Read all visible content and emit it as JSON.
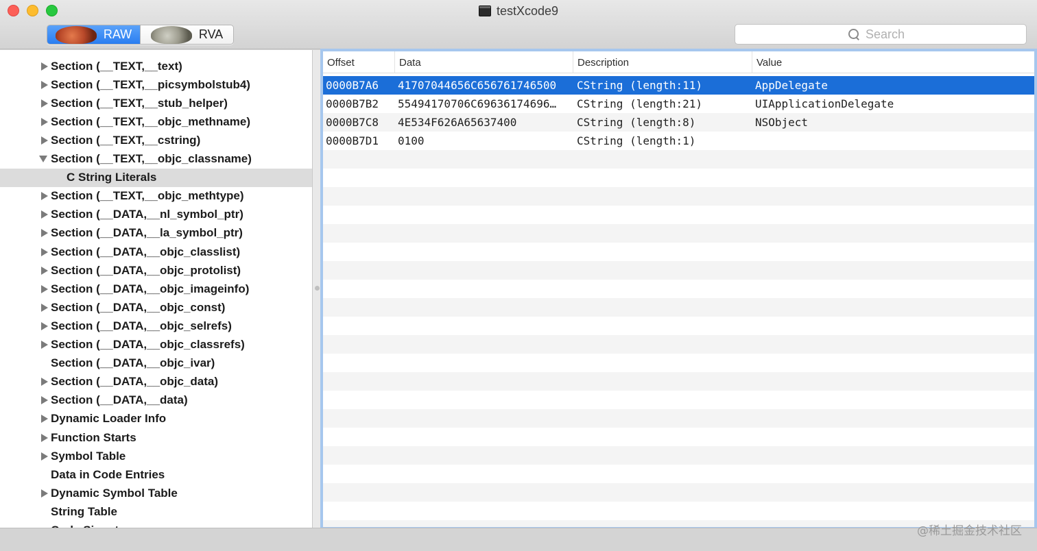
{
  "window": {
    "title": "testXcode9"
  },
  "toolbar": {
    "segments": [
      {
        "label": "RAW",
        "selected": true
      },
      {
        "label": "RVA",
        "selected": false
      }
    ],
    "search": {
      "placeholder": "Search",
      "value": ""
    }
  },
  "outline": {
    "items": [
      {
        "label": "Section (__TEXT,__text)",
        "disclosure": "closed",
        "level": 1
      },
      {
        "label": "Section (__TEXT,__picsymbolstub4)",
        "disclosure": "closed",
        "level": 1
      },
      {
        "label": "Section (__TEXT,__stub_helper)",
        "disclosure": "closed",
        "level": 1
      },
      {
        "label": "Section (__TEXT,__objc_methname)",
        "disclosure": "closed",
        "level": 1
      },
      {
        "label": "Section (__TEXT,__cstring)",
        "disclosure": "closed",
        "level": 1
      },
      {
        "label": "Section (__TEXT,__objc_classname)",
        "disclosure": "open",
        "level": 1
      },
      {
        "label": "C String Literals",
        "disclosure": "none",
        "level": 2,
        "selected": true
      },
      {
        "label": "Section (__TEXT,__objc_methtype)",
        "disclosure": "closed",
        "level": 1
      },
      {
        "label": "Section (__DATA,__nl_symbol_ptr)",
        "disclosure": "closed",
        "level": 1
      },
      {
        "label": "Section (__DATA,__la_symbol_ptr)",
        "disclosure": "closed",
        "level": 1
      },
      {
        "label": "Section (__DATA,__objc_classlist)",
        "disclosure": "closed",
        "level": 1
      },
      {
        "label": "Section (__DATA,__objc_protolist)",
        "disclosure": "closed",
        "level": 1
      },
      {
        "label": "Section (__DATA,__objc_imageinfo)",
        "disclosure": "closed",
        "level": 1
      },
      {
        "label": "Section (__DATA,__objc_const)",
        "disclosure": "closed",
        "level": 1
      },
      {
        "label": "Section (__DATA,__objc_selrefs)",
        "disclosure": "closed",
        "level": 1
      },
      {
        "label": "Section (__DATA,__objc_classrefs)",
        "disclosure": "closed",
        "level": 1
      },
      {
        "label": "Section (__DATA,__objc_ivar)",
        "disclosure": "none",
        "level": 1
      },
      {
        "label": "Section (__DATA,__objc_data)",
        "disclosure": "closed",
        "level": 1
      },
      {
        "label": "Section (__DATA,__data)",
        "disclosure": "closed",
        "level": 1
      },
      {
        "label": "Dynamic Loader Info",
        "disclosure": "closed",
        "level": 1
      },
      {
        "label": "Function Starts",
        "disclosure": "closed",
        "level": 1
      },
      {
        "label": "Symbol Table",
        "disclosure": "closed",
        "level": 1
      },
      {
        "label": "Data in Code Entries",
        "disclosure": "none",
        "level": 1
      },
      {
        "label": "Dynamic Symbol Table",
        "disclosure": "closed",
        "level": 1
      },
      {
        "label": "String Table",
        "disclosure": "none",
        "level": 1
      },
      {
        "label": "Code Signature",
        "disclosure": "none",
        "level": 1
      }
    ]
  },
  "table": {
    "columns": [
      "Offset",
      "Data",
      "Description",
      "Value"
    ],
    "rows": [
      {
        "offset": "0000B7A6",
        "data": "41707044656C656761746500",
        "description": "CString (length:11)",
        "value": "AppDelegate",
        "selected": true
      },
      {
        "offset": "0000B7B2",
        "data": "55494170706C69636174696…",
        "description": "CString (length:21)",
        "value": "UIApplicationDelegate",
        "selected": false
      },
      {
        "offset": "0000B7C8",
        "data": "4E534F626A65637400",
        "description": "CString (length:8)",
        "value": "NSObject",
        "selected": false
      },
      {
        "offset": "0000B7D1",
        "data": "0100",
        "description": "CString (length:1)",
        "value": "",
        "selected": false
      }
    ]
  },
  "watermark": "@稀土掘金技术社区",
  "colors": {
    "selection": "#1b6ed8",
    "focus_ring": "#a6c7ee",
    "close": "#fc5f57",
    "minimize": "#fdbc2e",
    "zoom": "#28c840"
  }
}
